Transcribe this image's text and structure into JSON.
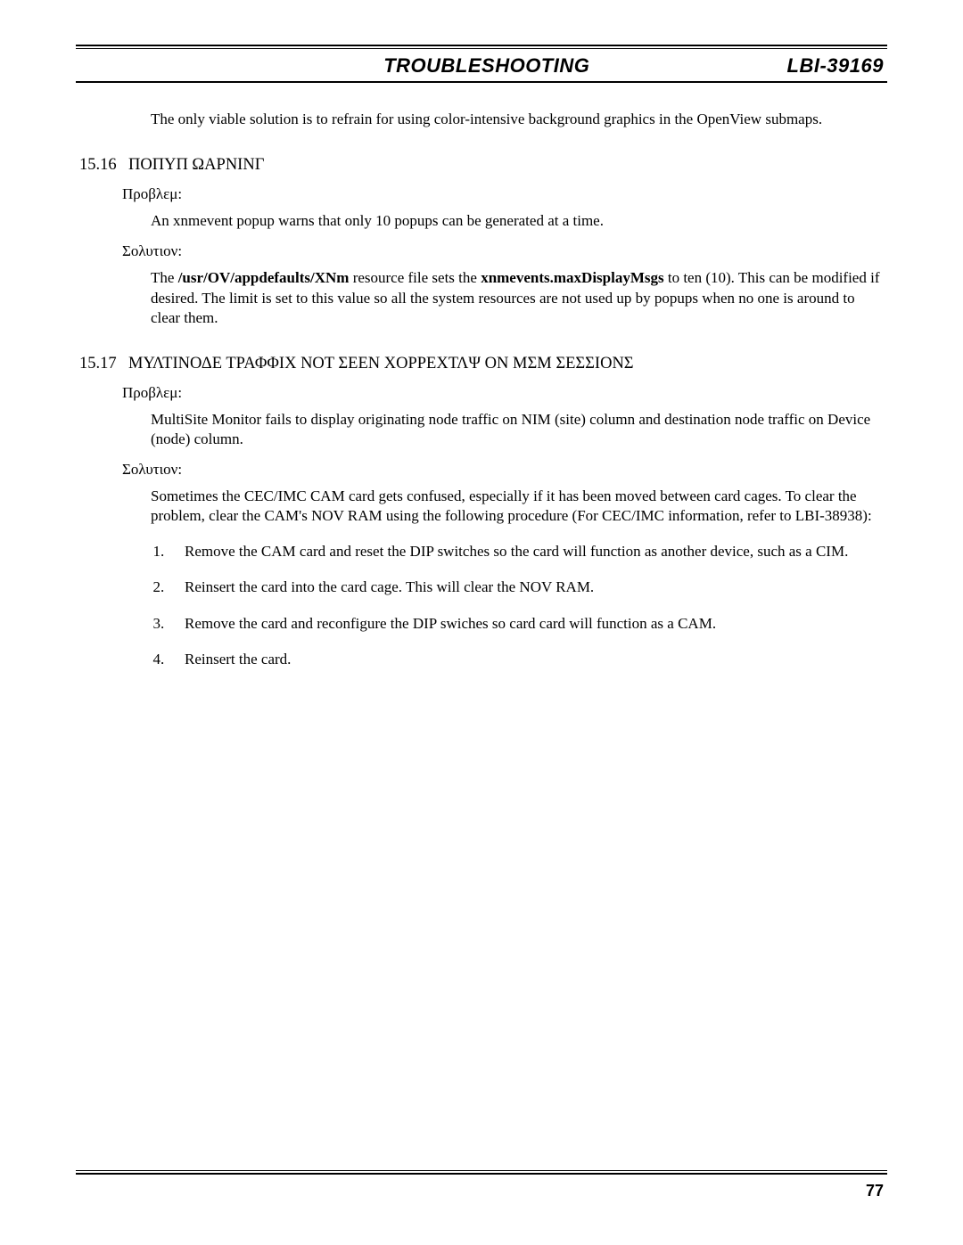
{
  "header": {
    "title": "TROUBLESHOOTING",
    "doc_id": "LBI-39169"
  },
  "intro": "The only viable solution is to refrain for using color-intensive background graphics in the OpenView submaps.",
  "section16": {
    "num": "15.16",
    "title": "ΠΟΠΥΠ ΩΑΡΝΙΝΓ",
    "problem_label": "Προβλεμ:",
    "problem_text": "An xnmevent popup warns that only 10 popups can be generated at a time.",
    "solution_label": "Σολυτιον:",
    "solution_pre": "The ",
    "solution_bold1": "/usr/OV/appdefaults/XNm",
    "solution_mid1": " resource file sets the ",
    "solution_bold2": "xnmevents.maxDisplayMsgs",
    "solution_post": " to ten (10).  This can be modified if desired.  The limit is set to this value so all the system resources are not used up by popups when no one is around to clear them."
  },
  "section17": {
    "num": "15.17",
    "title": "ΜΥΛΤΙΝΟΔΕ ΤΡΑΦΦΙΧ ΝΟΤ ΣΕΕΝ ΧΟΡΡΕΧΤΛΨ ΟΝ ΜΣΜ ΣΕΣΣΙΟΝΣ",
    "problem_label": "Προβλεμ:",
    "problem_text": "MultiSite Monitor fails to display originating node traffic on NIM (site) column and destination node traffic on Device (node) column.",
    "solution_label": "Σολυτιον:",
    "solution_text": "Sometimes the CEC/IMC CAM card gets confused, especially if it has been moved between card cages.  To clear the problem, clear the CAM's NOV RAM using the following procedure (For CEC/IMC information, refer to LBI-38938):",
    "steps": [
      "Remove the CAM card and reset the DIP switches so the card will function as another device, such as a CIM.",
      "Reinsert the card into the card cage.  This will clear the NOV RAM.",
      "Remove the card and reconfigure the DIP swiches so card card will function as a CAM.",
      "Reinsert the card."
    ]
  },
  "page_number": "77"
}
